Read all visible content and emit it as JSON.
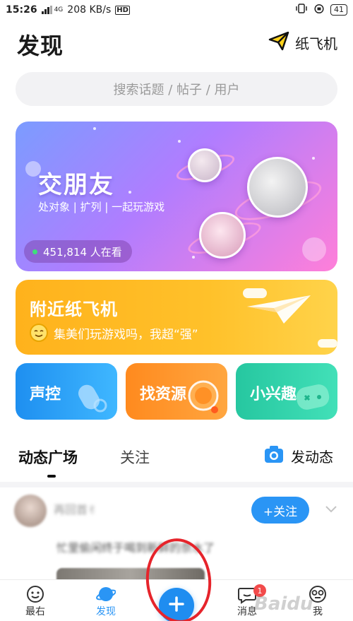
{
  "status_bar": {
    "time": "15:26",
    "network": "4G",
    "speed": "208 KB/s",
    "hd": "HD",
    "battery": "41"
  },
  "header": {
    "title": "发现",
    "plane_label": "纸飞机"
  },
  "search": {
    "placeholder": "搜索话题 / 帖子 / 用户"
  },
  "banner_friends": {
    "title": "交朋友",
    "subtitle": "处对象 | 扩列 | 一起玩游戏",
    "viewers": "451,814 人在看"
  },
  "banner_plane": {
    "title": "附近纸飞机",
    "subtitle": "集美们玩游戏吗，我超“强”"
  },
  "tiles": [
    {
      "label": "声控"
    },
    {
      "label": "找资源"
    },
    {
      "label": "小兴趣"
    }
  ],
  "feed_tabs": {
    "square": "动态广场",
    "follow": "关注",
    "post_label": "发动态"
  },
  "post": {
    "username": "再回首✌",
    "follow_label": "+关注",
    "text": "忙里偷闲终于喝到新鲜的奈水了"
  },
  "bottom_nav": {
    "latest": "最右",
    "discover": "发现",
    "messages": "消息",
    "messages_badge": "1",
    "me": "我"
  },
  "watermark": "Baidu",
  "colors": {
    "accent": "#2a95f5",
    "badge": "#f24b4b",
    "highlight": "#e6242b"
  }
}
